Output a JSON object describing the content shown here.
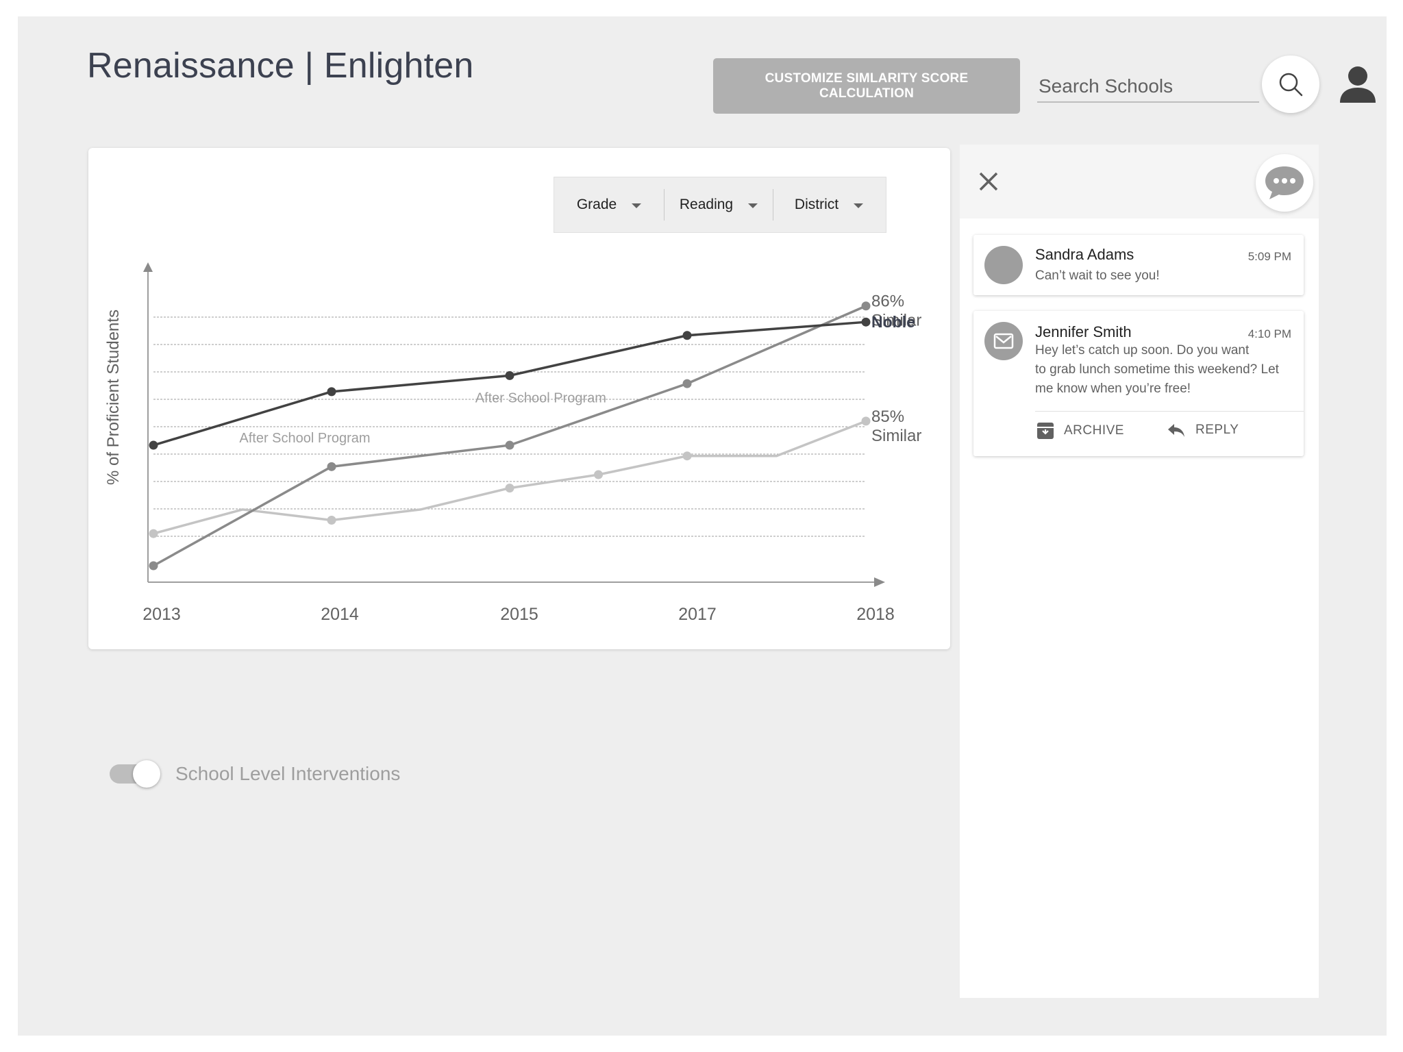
{
  "app": {
    "title": "Renaissance | Enlighten"
  },
  "header": {
    "customize_label": "CUSTOMIZE SIMLARITY SCORE CALCULATION",
    "search_placeholder": "Search Schools",
    "icons": {
      "search": "search-icon",
      "account": "account-icon"
    }
  },
  "filters": [
    {
      "label": "Grade"
    },
    {
      "label": "Reading"
    },
    {
      "label": "District"
    }
  ],
  "chart_data": {
    "type": "line",
    "ylabel": "% of Proficient Students",
    "xlabel": "",
    "categories": [
      "2013",
      "2014",
      "2015",
      "2017",
      "2018"
    ],
    "series": [
      {
        "name": "Noble",
        "color": "#424242",
        "points": [
          [
            2013,
            0.45
          ],
          [
            2014,
            0.65
          ],
          [
            2015,
            0.71
          ],
          [
            2017,
            0.86
          ],
          [
            2018,
            0.91
          ]
        ]
      },
      {
        "name": "86% Similar",
        "color": "#8a8a8a",
        "points": [
          [
            2013,
            0.0
          ],
          [
            2014,
            0.37
          ],
          [
            2015,
            0.45
          ],
          [
            2017,
            0.68
          ],
          [
            2018,
            0.97
          ]
        ]
      },
      {
        "name": "85% Similar",
        "color": "#c4c4c4",
        "points": [
          [
            2013,
            0.12
          ],
          [
            2013.5,
            0.21
          ],
          [
            2014,
            0.17
          ],
          [
            2014.5,
            0.21
          ],
          [
            2015,
            0.29
          ],
          [
            2016,
            0.34
          ],
          [
            2017,
            0.41
          ],
          [
            2017.5,
            0.41
          ],
          [
            2018,
            0.54
          ]
        ]
      }
    ],
    "series_labels": [
      {
        "series": 1,
        "lines": [
          "86%",
          "Similar"
        ]
      },
      {
        "series": 0,
        "lines": [
          "Noble"
        ]
      },
      {
        "series": 2,
        "lines": [
          "85%",
          "Similar"
        ]
      }
    ],
    "annotations": [
      {
        "text": "After School Program",
        "x": 2013.85,
        "y": 0.46
      },
      {
        "text": "After School Program",
        "x": 2015.35,
        "y": 0.61
      }
    ],
    "grid": true,
    "grid_lines": 9,
    "legend": "end-of-line labels"
  },
  "interventions": {
    "label": "School Level Interventions",
    "enabled": true
  },
  "panel": {
    "icons": {
      "close": "close-icon",
      "chat": "chat-icon"
    },
    "messages": [
      {
        "name": "Sandra Adams",
        "time": "5:09 PM",
        "text": "Can’t wait to see you!"
      },
      {
        "name": "Jennifer Smith",
        "time": "4:10 PM",
        "text_lines": [
          "Hey let’s catch up soon. Do you want",
          "to grab lunch sometime this weekend? Let",
          "me know when you’re free!"
        ],
        "actions": {
          "archive": "ARCHIVE",
          "reply": "REPLY"
        }
      }
    ]
  }
}
